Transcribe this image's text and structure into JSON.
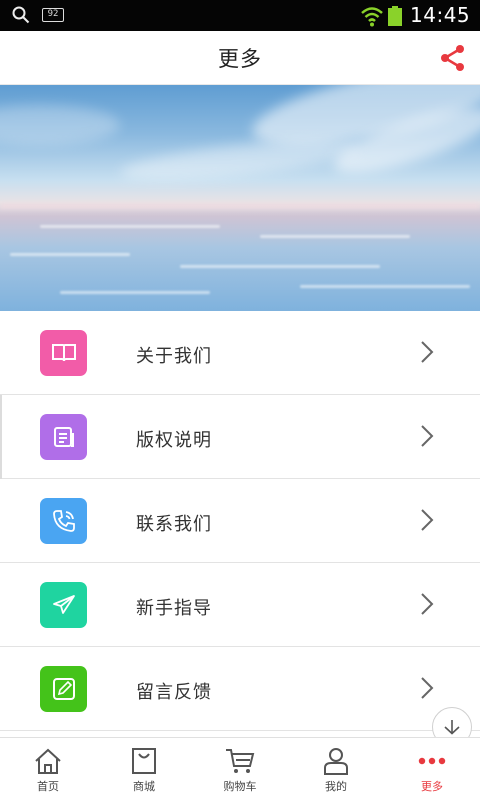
{
  "status_bar": {
    "notification_count": "92",
    "time": "14:45"
  },
  "header": {
    "title": "更多",
    "share_icon": "share-icon",
    "accent_color": "#e8393f"
  },
  "menu": {
    "items": [
      {
        "label": "关于我们",
        "icon": "book-icon",
        "color": "#f25ca8"
      },
      {
        "label": "版权说明",
        "icon": "document-icon",
        "color": "#b06ee8"
      },
      {
        "label": "联系我们",
        "icon": "phone-icon",
        "color": "#4aa5f2"
      },
      {
        "label": "新手指导",
        "icon": "send-icon",
        "color": "#1fd4a0"
      },
      {
        "label": "留言反馈",
        "icon": "edit-icon",
        "color": "#44c31a"
      }
    ]
  },
  "tab_bar": {
    "tabs": [
      {
        "label": "首页",
        "icon": "home-icon"
      },
      {
        "label": "商城",
        "icon": "shopping-bag-icon"
      },
      {
        "label": "购物车",
        "icon": "cart-icon"
      },
      {
        "label": "我的",
        "icon": "user-icon"
      },
      {
        "label": "更多",
        "icon": "more-dots-icon"
      }
    ],
    "active_index": 4
  }
}
